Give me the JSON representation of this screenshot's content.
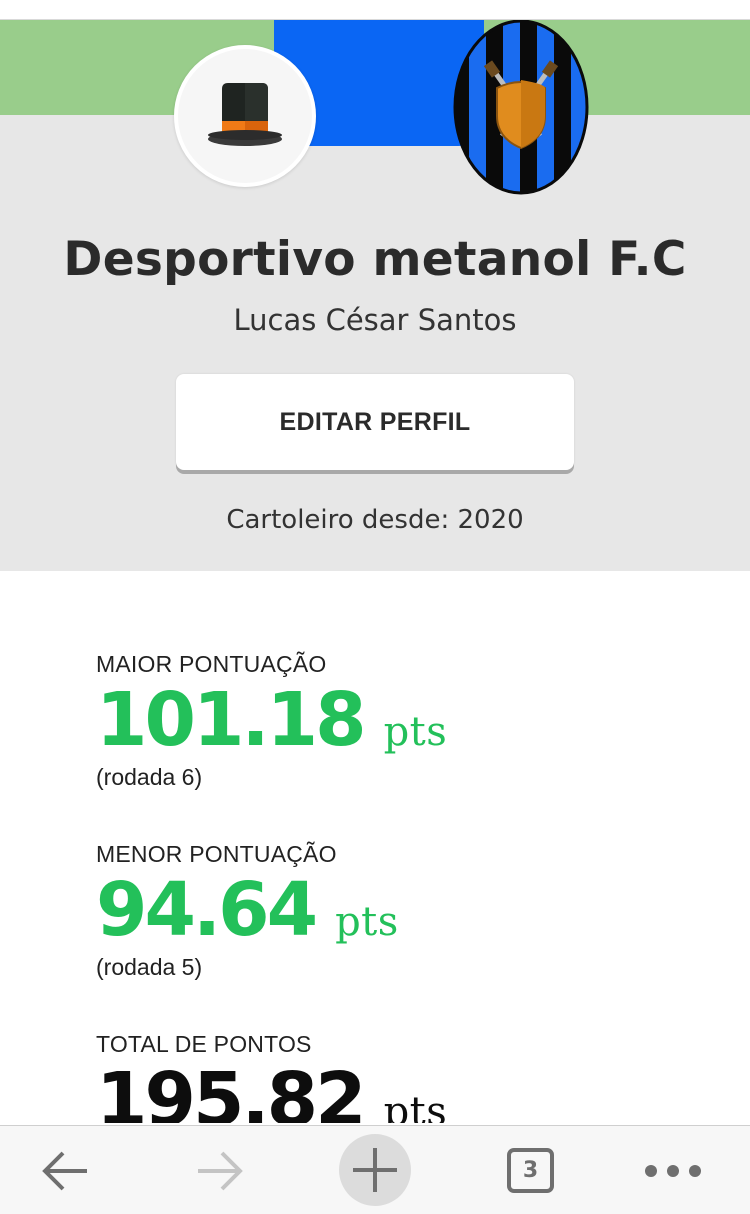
{
  "profile": {
    "team_name": "Desportivo metanol F.C",
    "owner_name": "Lucas César Santos",
    "edit_button_label": "EDITAR PERFIL",
    "member_since": "Cartoleiro desde: 2020",
    "avatar_icon": "top-hat-icon",
    "crest_icon": "shield-crossed-swords-crest",
    "colors": {
      "cover_green": "#99cd8b",
      "cover_blue": "#0a66f4",
      "header_bg": "#e7e7e7"
    }
  },
  "stats": [
    {
      "label": "MAIOR PONTUAÇÃO",
      "value": "101.18",
      "unit": "pts",
      "sub": "(rodada 6)",
      "color": "#23c05a"
    },
    {
      "label": "MENOR PONTUAÇÃO",
      "value": "94.64",
      "unit": "pts",
      "sub": "(rodada 5)",
      "color": "#23c05a"
    },
    {
      "label": "TOTAL DE PONTOS",
      "value": "195.82",
      "unit": "pts",
      "color": "#0d0d0d"
    }
  ],
  "browser_bar": {
    "back_icon": "arrow-left-icon",
    "forward_icon": "arrow-right-icon",
    "new_tab_icon": "plus-icon",
    "tab_count": "3",
    "menu_icon": "more-dots-icon"
  }
}
